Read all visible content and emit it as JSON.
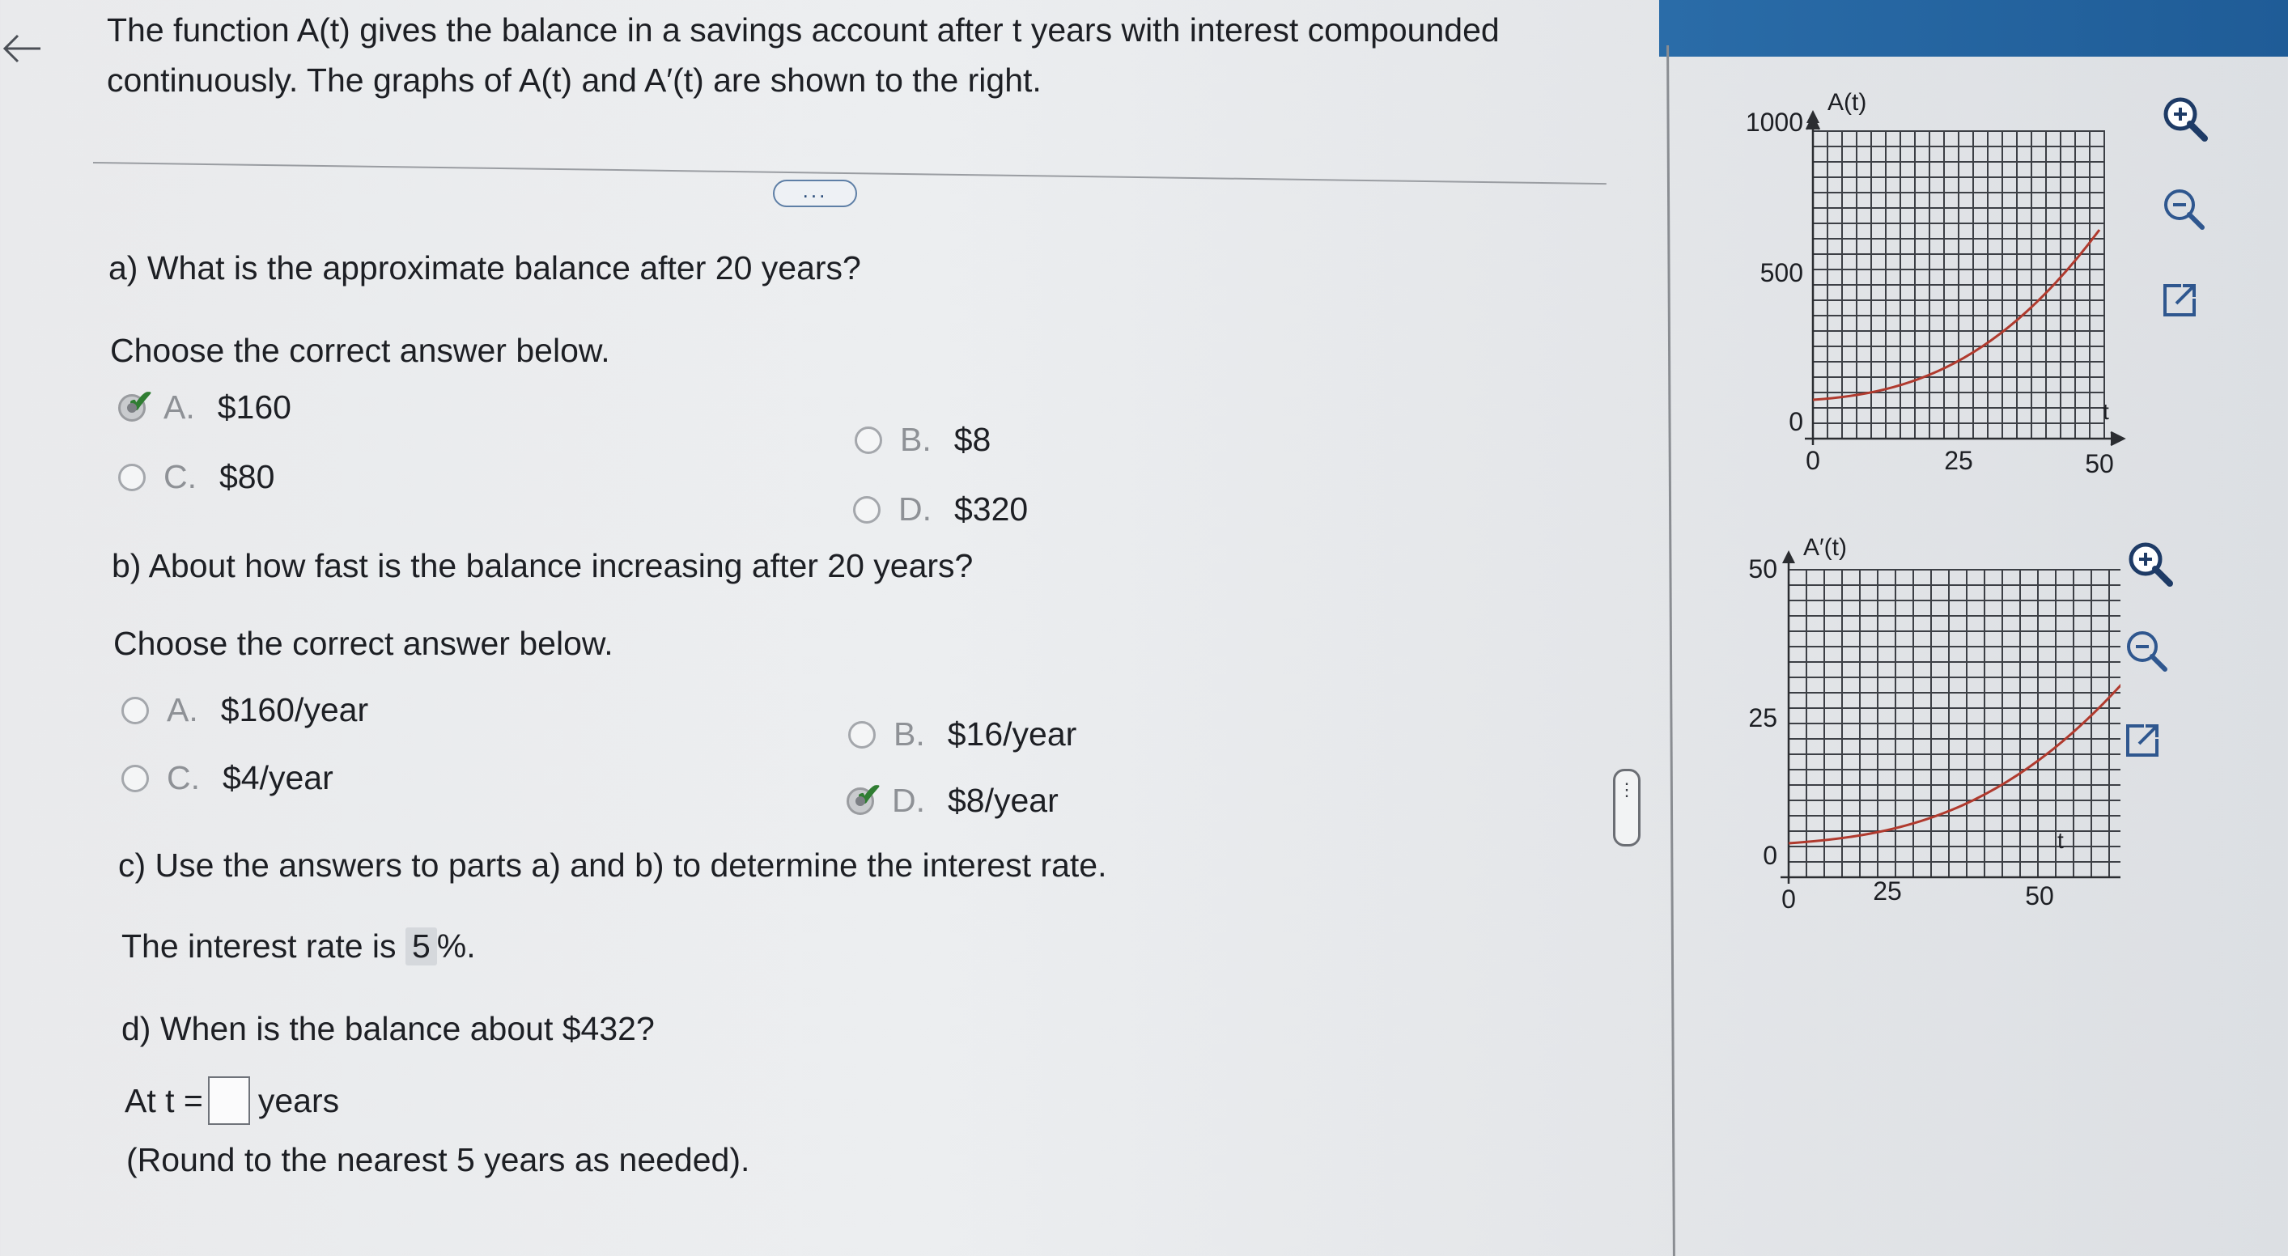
{
  "problem": {
    "intro": "The function A(t) gives the balance in a savings account after t years with interest compounded continuously. The graphs of A(t) and A′(t) are shown to the right.",
    "more_label": "..."
  },
  "part_a": {
    "question": "a) What is the approximate balance after 20 years?",
    "prompt": "Choose the correct answer below.",
    "options": [
      {
        "letter": "A.",
        "text": "$160",
        "selected": true
      },
      {
        "letter": "B.",
        "text": "$8",
        "selected": false
      },
      {
        "letter": "C.",
        "text": "$80",
        "selected": false
      },
      {
        "letter": "D.",
        "text": "$320",
        "selected": false
      }
    ]
  },
  "part_b": {
    "question": "b) About how fast is the balance increasing after 20 years?",
    "prompt": "Choose the correct answer below.",
    "options": [
      {
        "letter": "A.",
        "text": "$160/year",
        "selected": false
      },
      {
        "letter": "B.",
        "text": "$16/year",
        "selected": false
      },
      {
        "letter": "C.",
        "text": "$4/year",
        "selected": false
      },
      {
        "letter": "D.",
        "text": "$8/year",
        "selected": true
      }
    ]
  },
  "part_c": {
    "question": "c) Use the answers to parts a) and b) to determine the interest rate.",
    "prefix": "The interest rate is",
    "value": "5",
    "suffix": "%."
  },
  "part_d": {
    "question": "d) When is the balance about $432?",
    "prefix": "At t =",
    "suffix": "years",
    "note": "(Round to the nearest 5 years as needed)."
  },
  "graph_top": {
    "ylabel": "A(t)",
    "xlabel": "t",
    "y_ticks": [
      "1000",
      "500",
      "0"
    ],
    "x_ticks": [
      "0",
      "25",
      "50"
    ]
  },
  "graph_bottom": {
    "ylabel": "A′(t)",
    "xlabel": "t",
    "y_ticks": [
      "50",
      "25",
      "0"
    ],
    "x_ticks": [
      "0",
      "25",
      "50"
    ]
  },
  "colors": {
    "curve": "#b03a2e",
    "grid": "#3c3f45",
    "check": "#2f7d32"
  }
}
